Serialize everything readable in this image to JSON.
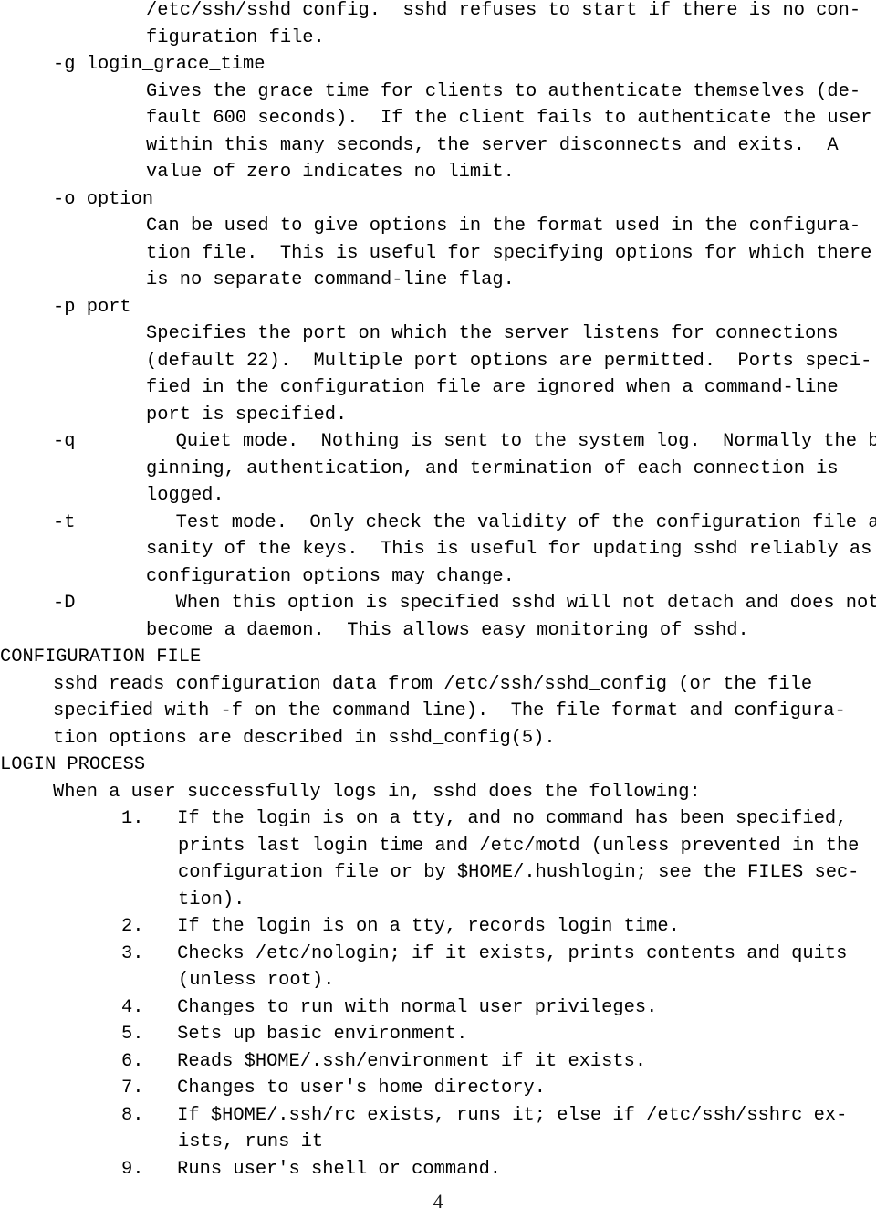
{
  "document": {
    "type": "man-page",
    "name": "sshd",
    "page_number": "4",
    "background_color": "#ffffff",
    "text_color": "#000000"
  },
  "lines": [
    {
      "id": "l01",
      "indent": 160,
      "text": "/etc/ssh/sshd_config.  sshd refuses to start if there is no con-"
    },
    {
      "id": "l02",
      "indent": 160,
      "text": "figuration file."
    },
    {
      "id": "l03",
      "indent": 58,
      "text": "-g login_grace_time"
    },
    {
      "id": "l04",
      "indent": 160,
      "text": "Gives the grace time for clients to authenticate themselves (de-"
    },
    {
      "id": "l05",
      "indent": 160,
      "text": "fault 600 seconds).  If the client fails to authenticate the user"
    },
    {
      "id": "l06",
      "indent": 160,
      "text": "within this many seconds, the server disconnects and exits.  A"
    },
    {
      "id": "l07",
      "indent": 160,
      "text": "value of zero indicates no limit."
    },
    {
      "id": "l08",
      "indent": 58,
      "text": "-o option"
    },
    {
      "id": "l09",
      "indent": 160,
      "text": "Can be used to give options in the format used in the configura-"
    },
    {
      "id": "l10",
      "indent": 160,
      "text": "tion file.  This is useful for specifying options for which there"
    },
    {
      "id": "l11",
      "indent": 160,
      "text": "is no separate command-line flag."
    },
    {
      "id": "l12",
      "indent": 58,
      "text": "-p port"
    },
    {
      "id": "l13",
      "indent": 160,
      "text": "Specifies the port on which the server listens for connections"
    },
    {
      "id": "l14",
      "indent": 160,
      "text": "(default 22).  Multiple port options are permitted.  Ports speci-"
    },
    {
      "id": "l15",
      "indent": 160,
      "text": "fied in the configuration file are ignored when a command-line"
    },
    {
      "id": "l16",
      "indent": 160,
      "text": "port is specified."
    },
    {
      "id": "l17",
      "indent": 58,
      "text": "-q         Quiet mode.  Nothing is sent to the system log.  Normally the be-"
    },
    {
      "id": "l18",
      "indent": 160,
      "text": "ginning, authentication, and termination of each connection is"
    },
    {
      "id": "l19",
      "indent": 160,
      "text": "logged."
    },
    {
      "id": "l20",
      "indent": 58,
      "text": "-t         Test mode.  Only check the validity of the configuration file and"
    },
    {
      "id": "l21",
      "indent": 160,
      "text": "sanity of the keys.  This is useful for updating sshd reliably as"
    },
    {
      "id": "l22",
      "indent": 160,
      "text": "configuration options may change."
    },
    {
      "id": "l23",
      "indent": 58,
      "text": "-D         When this option is specified sshd will not detach and does not"
    },
    {
      "id": "l24",
      "indent": 160,
      "text": "become a daemon.  This allows easy monitoring of sshd."
    },
    {
      "id": "l25",
      "indent": 0,
      "text": "CONFIGURATION FILE",
      "kind": "heading"
    },
    {
      "id": "l26",
      "indent": 58,
      "text": "sshd reads configuration data from /etc/ssh/sshd_config (or the file"
    },
    {
      "id": "l27",
      "indent": 58,
      "text": "specified with -f on the command line).  The file format and configura-"
    },
    {
      "id": "l28",
      "indent": 58,
      "text": "tion options are described in sshd_config(5)."
    },
    {
      "id": "l29",
      "indent": 0,
      "text": "LOGIN PROCESS",
      "kind": "heading"
    },
    {
      "id": "l30",
      "indent": 58,
      "text": "When a user successfully logs in, sshd does the following:"
    },
    {
      "id": "l31",
      "indent": 133,
      "text": "1.   If the login is on a tty, and no command has been specified,"
    },
    {
      "id": "l32",
      "indent": 195,
      "text": "prints last login time and /etc/motd (unless prevented in the"
    },
    {
      "id": "l33",
      "indent": 195,
      "text": "configuration file or by $HOME/.hushlogin; see the FILES sec-"
    },
    {
      "id": "l34",
      "indent": 195,
      "text": "tion)."
    },
    {
      "id": "l35",
      "indent": 133,
      "text": "2.   If the login is on a tty, records login time."
    },
    {
      "id": "l36",
      "indent": 133,
      "text": "3.   Checks /etc/nologin; if it exists, prints contents and quits"
    },
    {
      "id": "l37",
      "indent": 195,
      "text": "(unless root)."
    },
    {
      "id": "l38",
      "indent": 133,
      "text": "4.   Changes to run with normal user privileges."
    },
    {
      "id": "l39",
      "indent": 133,
      "text": "5.   Sets up basic environment."
    },
    {
      "id": "l40",
      "indent": 133,
      "text": "6.   Reads $HOME/.ssh/environment if it exists."
    },
    {
      "id": "l41",
      "indent": 133,
      "text": "7.   Changes to user's home directory."
    },
    {
      "id": "l42",
      "indent": 133,
      "text": "8.   If $HOME/.ssh/rc exists, runs it; else if /etc/ssh/sshrc ex-"
    },
    {
      "id": "l43",
      "indent": 195,
      "text": "ists, runs it"
    },
    {
      "id": "l44",
      "indent": 133,
      "text": "9.   Runs user's shell or command."
    }
  ],
  "sections": {
    "options": {
      "entries": [
        {
          "flag": "-g login_grace_time",
          "description": "Gives the grace time for clients to authenticate themselves (default 600 seconds).  If the client fails to authenticate the user within this many seconds, the server disconnects and exits.  A value of zero indicates no limit."
        },
        {
          "flag": "-o option",
          "description": "Can be used to give options in the format used in the configuration file.  This is useful for specifying options for which there is no separate command-line flag."
        },
        {
          "flag": "-p port",
          "description": "Specifies the port on which the server listens for connections (default 22).  Multiple port options are permitted.  Ports specified in the configuration file are ignored when a command-line port is specified."
        },
        {
          "flag": "-q",
          "description": "Quiet mode.  Nothing is sent to the system log.  Normally the beginning, authentication, and termination of each connection is logged."
        },
        {
          "flag": "-t",
          "description": "Test mode.  Only check the validity of the configuration file and sanity of the keys.  This is useful for updating sshd reliably as configuration options may change."
        },
        {
          "flag": "-D",
          "description": "When this option is specified sshd will not detach and does not become a daemon.  This allows easy monitoring of sshd."
        }
      ]
    },
    "configuration_file": {
      "heading": "CONFIGURATION FILE",
      "body": "sshd reads configuration data from /etc/ssh/sshd_config (or the file specified with -f on the command line).  The file format and configuration options are described in sshd_config(5)."
    },
    "login_process": {
      "heading": "LOGIN PROCESS",
      "intro": "When a user successfully logs in, sshd does the following:",
      "steps": [
        {
          "number": "1.",
          "text": "If the login is on a tty, and no command has been specified, prints last login time and /etc/motd (unless prevented in the configuration file or by $HOME/.hushlogin; see the FILES section)."
        },
        {
          "number": "2.",
          "text": "If the login is on a tty, records login time."
        },
        {
          "number": "3.",
          "text": "Checks /etc/nologin; if it exists, prints contents and quits (unless root)."
        },
        {
          "number": "4.",
          "text": "Changes to run with normal user privileges."
        },
        {
          "number": "5.",
          "text": "Sets up basic environment."
        },
        {
          "number": "6.",
          "text": "Reads $HOME/.ssh/environment if it exists."
        },
        {
          "number": "7.",
          "text": "Changes to user's home directory."
        },
        {
          "number": "8.",
          "text": "If $HOME/.ssh/rc exists, runs it; else if /etc/ssh/sshrc exists, runs it"
        },
        {
          "number": "9.",
          "text": "Runs user's shell or command."
        }
      ]
    }
  },
  "footer": {
    "page_number": "4"
  }
}
